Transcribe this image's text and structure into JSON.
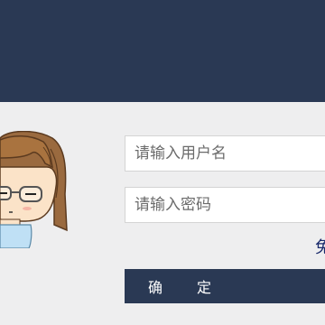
{
  "login_form": {
    "username_placeholder": "请输入用户名",
    "password_placeholder": "请输入密码",
    "link_text": "免",
    "confirm_label": "确定"
  },
  "colors": {
    "header_bg": "#2a3954",
    "page_bg": "#eeeeef",
    "button_bg": "#2a3954",
    "link_color": "#1a2a6b"
  },
  "icons": {
    "avatar": "cartoon-girl-with-glasses-avatar"
  }
}
